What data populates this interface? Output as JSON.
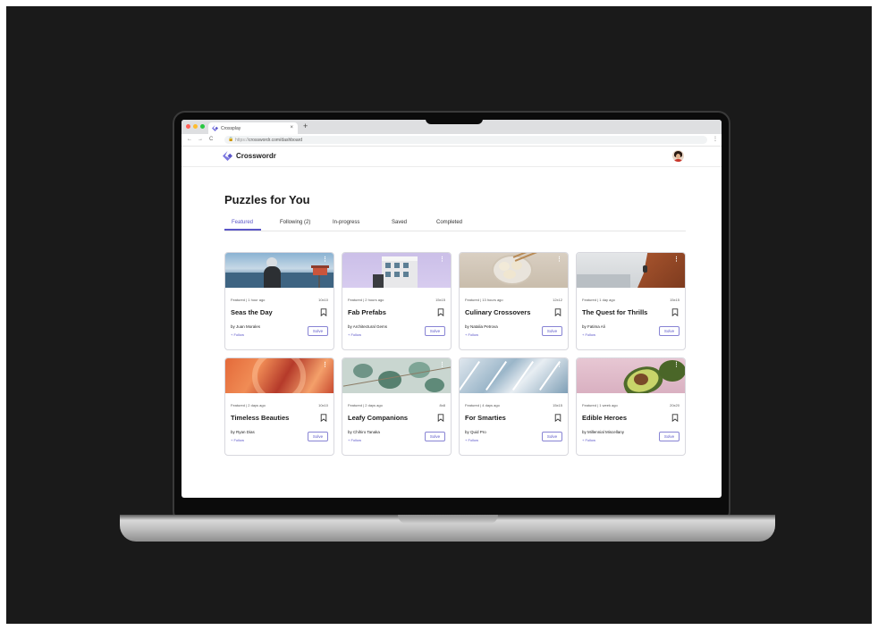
{
  "browser": {
    "tab_title": "Crossplay",
    "tab_close": "×",
    "new_tab": "+",
    "url_prefix": "https://",
    "url": "crosswordr.com/dashboard",
    "back": "←",
    "forward": "→",
    "reload": "C",
    "menu": "⋮"
  },
  "app": {
    "logo_text": "Crosswordr",
    "brand_color": "#5a55c8"
  },
  "page": {
    "title": "Puzzles for You",
    "tabs": [
      {
        "label": "Featured",
        "active": true
      },
      {
        "label": "Following (2)",
        "active": false
      },
      {
        "label": "In-progress",
        "active": false
      },
      {
        "label": "Saved",
        "active": false
      },
      {
        "label": "Completed",
        "active": false
      }
    ]
  },
  "card_labels": {
    "solve": "Solve",
    "follow": "+ Follow",
    "more": "⋮"
  },
  "puzzles": [
    {
      "meta": "Featured | 1 hour ago",
      "size": "10x10",
      "title": "Seas the Day",
      "author": "by Juan Morales"
    },
    {
      "meta": "Featured | 2 hours ago",
      "size": "15x15",
      "title": "Fab Prefabs",
      "author": "by Architectural Gems"
    },
    {
      "meta": "Featured | 13 hours ago",
      "size": "12x12",
      "title": "Culinary Crossovers",
      "author": "by Natalia Petrova"
    },
    {
      "meta": "Featured | 1 day ago",
      "size": "15x15",
      "title": "The Quest for Thrills",
      "author": "by Fatima Ali"
    },
    {
      "meta": "Featured | 2 days ago",
      "size": "10x10",
      "title": "Timeless Beauties",
      "author": "by Ryan Dias"
    },
    {
      "meta": "Featured | 2 days ago",
      "size": "8x8",
      "title": "Leafy Companions",
      "author": "by Chihiro Tanaka"
    },
    {
      "meta": "Featured | 4 days ago",
      "size": "15x15",
      "title": "For Smarties",
      "author": "by Quid Pro"
    },
    {
      "meta": "Featured | 1 week ago",
      "size": "20x20",
      "title": "Edible Heroes",
      "author": "by Millennial Miscellany"
    }
  ]
}
